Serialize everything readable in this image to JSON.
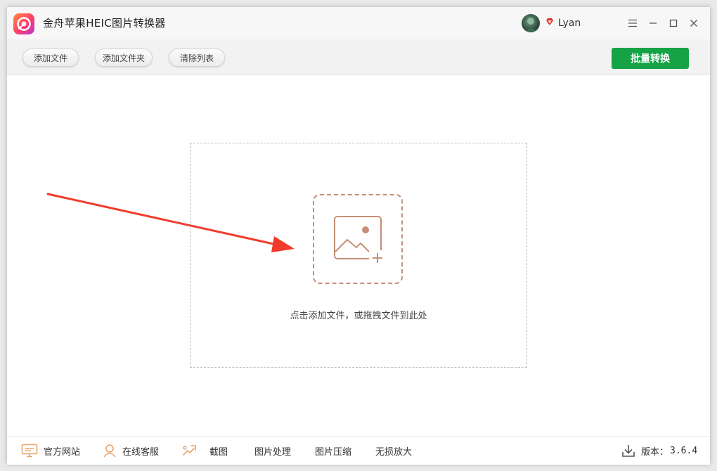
{
  "app": {
    "title": "金舟苹果HEIC图片转换器",
    "user": "Lyan"
  },
  "toolbar": {
    "add_file": "添加文件",
    "add_folder": "添加文件夹",
    "clear_list": "清除列表",
    "batch_convert": "批量转换"
  },
  "main": {
    "drop_hint": "点击添加文件，或拖拽文件到此处"
  },
  "footer": {
    "items": [
      {
        "label": "官方网站",
        "icon": "monitor-icon"
      },
      {
        "label": "在线客服",
        "icon": "customer-service-icon"
      },
      {
        "label": "截图",
        "icon": "screenshot-icon"
      },
      {
        "label": "图片处理"
      },
      {
        "label": "图片压缩"
      },
      {
        "label": "无损放大"
      }
    ],
    "version_label": "版本：",
    "version_number": "3.6.4"
  },
  "colors": {
    "accent_green": "#15a346",
    "drop_icon": "#c58f77",
    "annotation_arrow": "#f23b2d",
    "footer_icon": "#e8a468"
  }
}
